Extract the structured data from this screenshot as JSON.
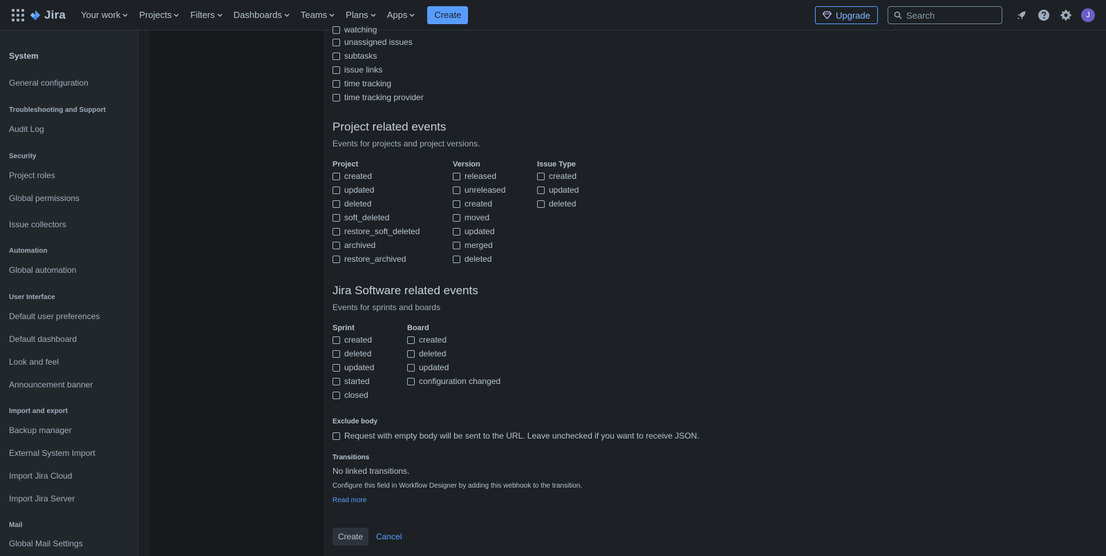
{
  "topnav": {
    "logo": "Jira",
    "items": [
      "Your work",
      "Projects",
      "Filters",
      "Dashboards",
      "Teams",
      "Plans",
      "Apps"
    ],
    "create": "Create",
    "upgrade": "Upgrade",
    "search_placeholder": "Search",
    "avatar_initial": "J"
  },
  "sidebar": {
    "title": "System",
    "general": "General configuration",
    "troubleshooting": "Troubleshooting and Support",
    "audit_log": "Audit Log",
    "security": "Security",
    "project_roles": "Project roles",
    "global_permissions": "Global permissions",
    "issue_collectors": "Issue collectors",
    "automation": "Automation",
    "global_automation": "Global automation",
    "user_interface": "User Interface",
    "default_user_prefs": "Default user preferences",
    "default_dashboard": "Default dashboard",
    "look_and_feel": "Look and feel",
    "announcement_banner": "Announcement banner",
    "import_export": "Import and export",
    "backup_manager": "Backup manager",
    "external_import": "External System Import",
    "import_cloud": "Import Jira Cloud",
    "import_server": "Import Jira Server",
    "mail": "Mail",
    "global_mail": "Global Mail Settings"
  },
  "top_checkboxes": [
    "watching",
    "unassigned issues",
    "subtasks",
    "issue links",
    "time tracking",
    "time tracking provider"
  ],
  "project_section": {
    "title": "Project related events",
    "description": "Events for projects and project versions.",
    "project_head": "Project",
    "project_items": [
      "created",
      "updated",
      "deleted",
      "soft_deleted",
      "restore_soft_deleted",
      "archived",
      "restore_archived"
    ],
    "version_head": "Version",
    "version_items": [
      "released",
      "unreleased",
      "created",
      "moved",
      "updated",
      "merged",
      "deleted"
    ],
    "issue_type_head": "Issue Type",
    "issue_type_items": [
      "created",
      "updated",
      "deleted"
    ]
  },
  "software_section": {
    "title": "Jira Software related events",
    "description": "Events for sprints and boards",
    "sprint_head": "Sprint",
    "sprint_items": [
      "created",
      "deleted",
      "updated",
      "started",
      "closed"
    ],
    "board_head": "Board",
    "board_items": [
      "created",
      "deleted",
      "updated",
      "configuration changed"
    ]
  },
  "exclude_body": {
    "head": "Exclude body",
    "label": "Request with empty body will be sent to the URL. Leave unchecked if you want to receive JSON."
  },
  "transitions": {
    "head": "Transitions",
    "none": "No linked transitions.",
    "hint": "Configure this field in Workflow Designer by adding this webhook to the transition.",
    "read_more": "Read more"
  },
  "actions": {
    "create": "Create",
    "cancel": "Cancel"
  }
}
